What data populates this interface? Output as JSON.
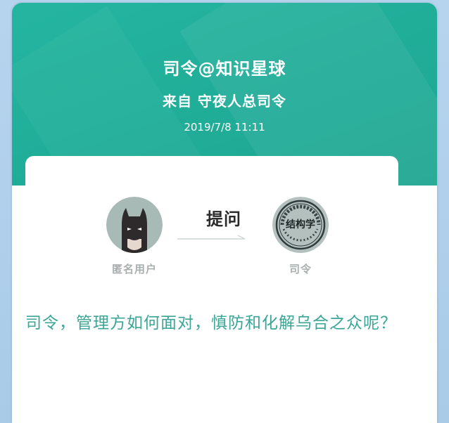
{
  "header": {
    "title": "司令@知识星球",
    "subtitle": "来自 守夜人总司令",
    "datetime": "2019/7/8  11:11"
  },
  "exchange": {
    "asker": {
      "name": "匿名用户",
      "avatar_icon": "batman-mask-icon"
    },
    "action": "提问",
    "answerer": {
      "name": "司令",
      "avatar_icon": "seal-stamp-icon",
      "seal_text": "结构学",
      "seal_ring_text": "司令总人夜守在我听首先结构"
    }
  },
  "question": "司令，管理方如何面对，慎防和化解乌合之众呢？",
  "colors": {
    "header_bg": "#22b09b",
    "question_text": "#3ba596",
    "name_text": "#a9aeae",
    "outer_bg": "#b7d4ee"
  }
}
